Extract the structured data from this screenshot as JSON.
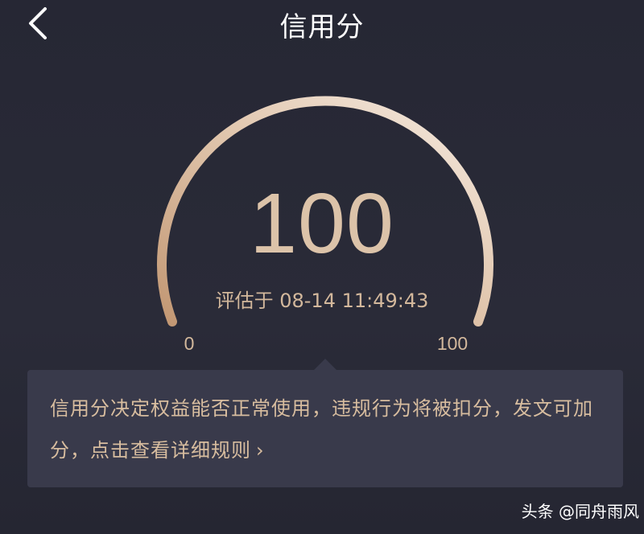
{
  "header": {
    "title": "信用分",
    "back_icon": "chevron-left-icon"
  },
  "score": {
    "value": "100",
    "min_label": "0",
    "max_label": "100",
    "level": 1.0,
    "evaluated_prefix": "评估于",
    "evaluated_time": "08-14 11:49:43"
  },
  "info": {
    "text": "信用分决定权益能否正常使用，违规行为将被扣分，发文可加分，点击查看详细规则",
    "link_icon": "chevron-right-icon",
    "link_glyph": "›"
  },
  "watermark": {
    "text": "头条 @同舟雨风"
  },
  "colors": {
    "background": "#272835",
    "gauge_start": "#c79d78",
    "gauge_end": "#f3e6da",
    "accent_text": "#d8bd9f",
    "panel": "#393a4b"
  }
}
